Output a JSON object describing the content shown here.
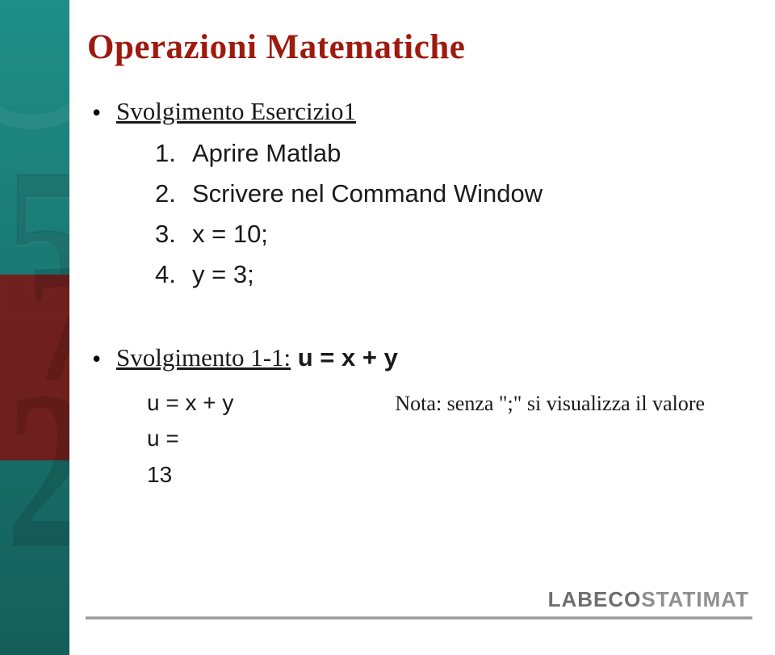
{
  "title": "Operazioni Matematiche",
  "bullet1": {
    "label": "Svolgimento Esercizio1",
    "items": [
      {
        "ord": "1.",
        "text": "Aprire Matlab"
      },
      {
        "ord": "2.",
        "text": "Scrivere nel Command Window"
      },
      {
        "ord": "3.",
        "text": "x = 10;"
      },
      {
        "ord": "4.",
        "text": "y = 3;"
      }
    ]
  },
  "bullet2": {
    "label_prefix": "Svolgimento 1-1:",
    "label_expr": " u = x + y",
    "result": {
      "line1_left": "u = x + y",
      "line1_note": "Nota: senza \";\" si visualizza il valore",
      "line2": "u =",
      "line3": "13"
    }
  },
  "footer_logo": {
    "dark": "LABECO",
    "light": "STATIMAT"
  },
  "decorative_numbers": {
    "a": "5",
    "b": "7",
    "c": "2"
  }
}
